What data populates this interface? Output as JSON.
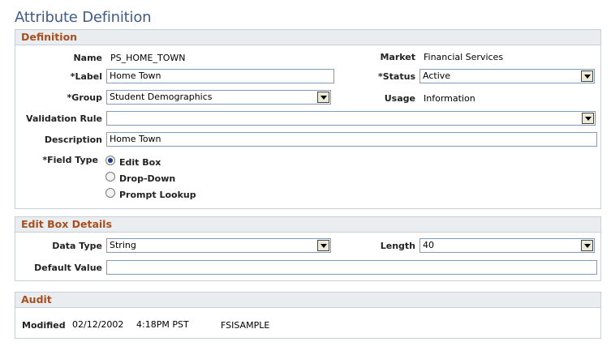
{
  "page_title": "Attribute Definition",
  "definition": {
    "header": "Definition",
    "name_label": "Name",
    "name_value": "PS_HOME_TOWN",
    "market_label": "Market",
    "market_value": "Financial Services",
    "label_label": "*Label",
    "label_value": "Home Town",
    "status_label": "*Status",
    "status_value": "Active",
    "group_label": "*Group",
    "group_value": "Student Demographics",
    "usage_label": "Usage",
    "usage_value": "Information",
    "validation_label": "Validation Rule",
    "validation_value": "",
    "description_label": "Description",
    "description_value": "Home Town",
    "field_type_label": "*Field Type",
    "field_type_options": [
      "Edit Box",
      "Drop-Down",
      "Prompt Lookup"
    ],
    "field_type_selected": "Edit Box"
  },
  "edit_box": {
    "header": "Edit Box Details",
    "data_type_label": "Data Type",
    "data_type_value": "String",
    "length_label": "Length",
    "length_value": "40",
    "default_label": "Default Value",
    "default_value": ""
  },
  "audit": {
    "header": "Audit",
    "modified_label": "Modified",
    "modified_date": "02/12/2002",
    "modified_time": "4:18PM PST",
    "modified_by": "FSISAMPLE"
  }
}
